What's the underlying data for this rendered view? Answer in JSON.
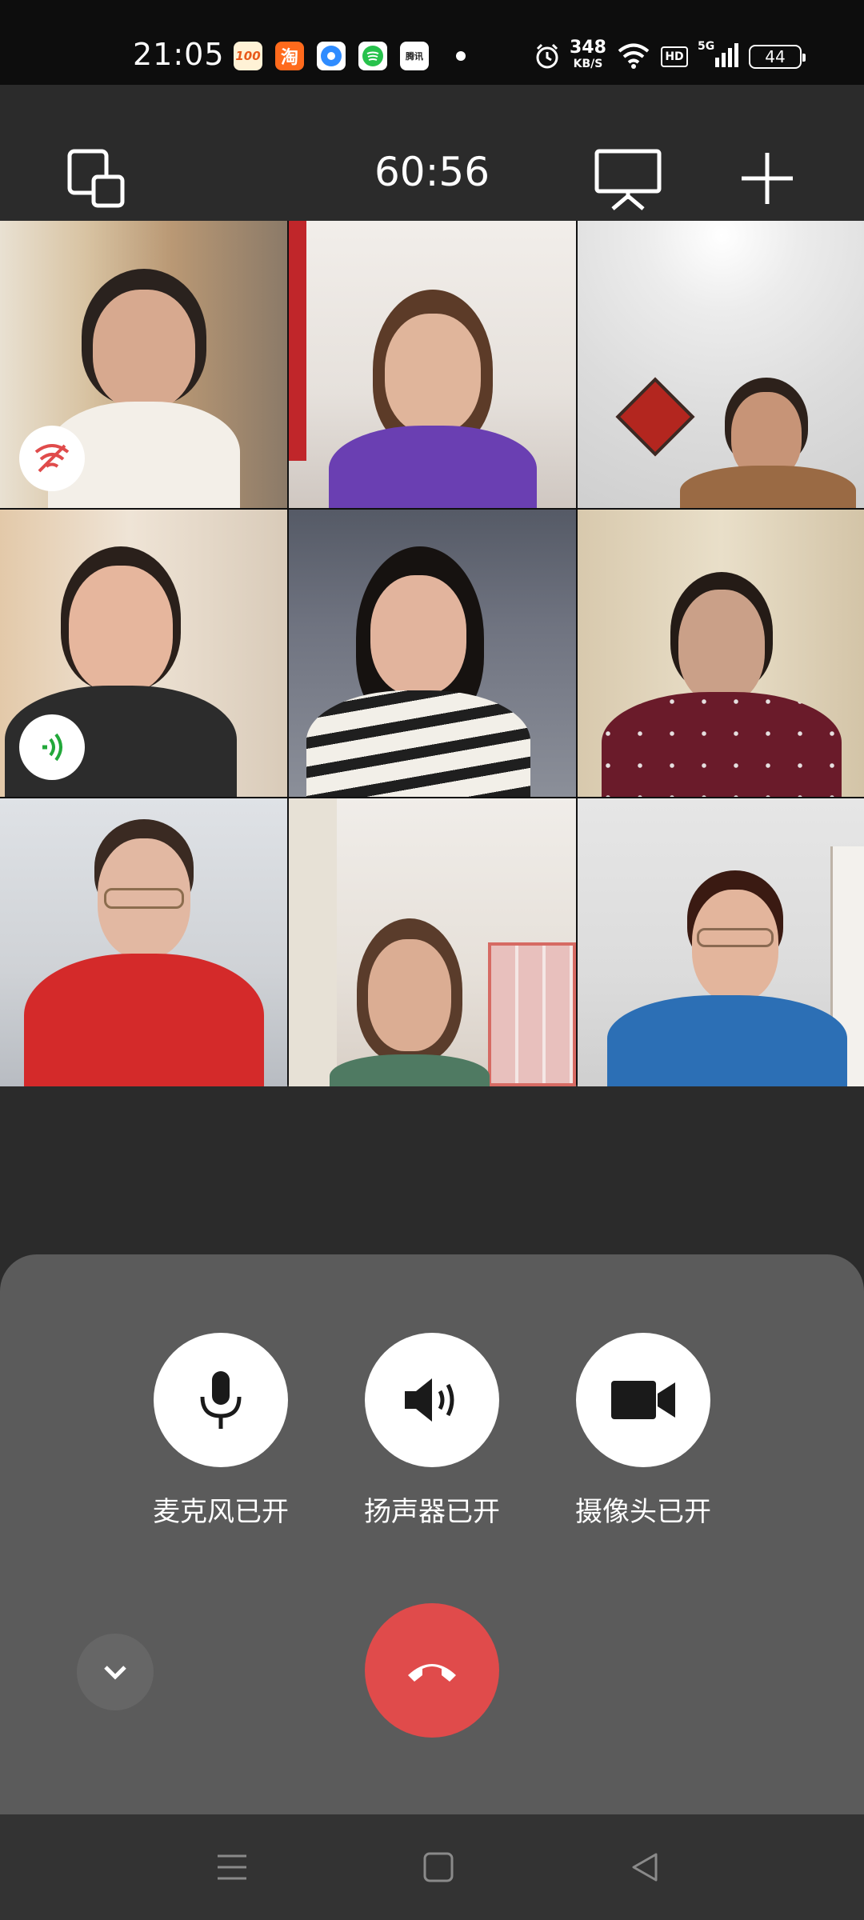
{
  "status_bar": {
    "time": "21:05",
    "apps": [
      {
        "icon": "app-100-icon",
        "text": "100",
        "bg": "#fff2d6",
        "fg": "#e85a1a"
      },
      {
        "icon": "taobao-icon",
        "text": "淘",
        "bg": "#ff6a1c",
        "fg": "#ffffff"
      },
      {
        "icon": "browser-icon",
        "text": "",
        "bg": "#2f8cff",
        "fg": "#ffffff"
      },
      {
        "icon": "spotify-like-icon",
        "text": "",
        "bg": "#27c24c",
        "fg": "#ffffff"
      },
      {
        "icon": "news-icon",
        "text": "腾讯",
        "bg": "#ffffff",
        "fg": "#222222"
      }
    ],
    "speed_value": "348",
    "speed_unit": "KB/S",
    "hd": "HD",
    "network": "5G",
    "battery": "44"
  },
  "top_bar": {
    "timer": "60:56"
  },
  "controls": {
    "mic_label": "麦克风已开",
    "speaker_label": "扬声器已开",
    "camera_label": "摄像头已开"
  },
  "colors": {
    "hangup": "#e04b4b",
    "panel": "#5b5b5b",
    "muted_badge": "#e04b4b",
    "speaking_badge": "#22a83a"
  }
}
